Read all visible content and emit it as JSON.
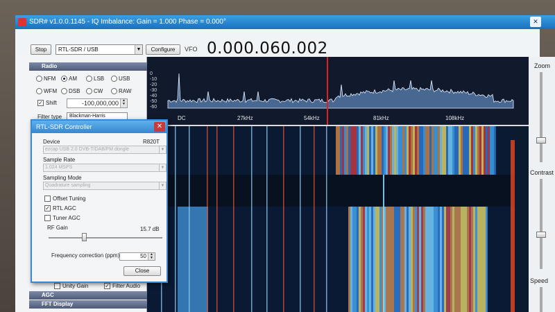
{
  "window": {
    "title": "SDR# v1.0.0.1145 - IQ Imbalance: Gain = 1.000 Phase = 0.000°",
    "close_glyph": "✕"
  },
  "toolbar": {
    "stop_label": "Stop",
    "source_value": "RTL-SDR / USB",
    "configure_label": "Configure",
    "vfo_label": "VFO",
    "vfo_value": "0.000.060.002"
  },
  "radio_panel": {
    "header": "Radio",
    "modes_row1": [
      "NFM",
      "AM",
      "LSB",
      "USB"
    ],
    "modes_row2": [
      "WFM",
      "DSB",
      "CW",
      "RAW"
    ],
    "selected_mode": "AM",
    "shift_label": "Shift",
    "shift_value": "-100,000,000",
    "filter_label": "Filter type",
    "filter_value": "Blackman-Harris"
  },
  "bottom_panel": {
    "unity_gain_label": "Unity Gain",
    "filter_audio_label": "Filter Audio",
    "agc_header": "AGC",
    "fft_header": "FFT Display"
  },
  "spectrum": {
    "db_ticks": [
      "0",
      "-10",
      "-20",
      "-30",
      "-40",
      "-50",
      "-60"
    ],
    "freq_labels": [
      "DC",
      "27kHz",
      "54kHz",
      "81kHz",
      "108kHz"
    ]
  },
  "right_panel": {
    "zoom_label": "Zoom",
    "contrast_label": "Contrast",
    "speed_label": "Speed"
  },
  "dialog": {
    "title": "RTL-SDR Controller",
    "close_glyph": "✕",
    "device_label": "Device",
    "device_tuner": "R820T",
    "device_value": "ezcap USB 2.0 DVB-T/DAB/FM dongle",
    "sample_rate_label": "Sample Rate",
    "sample_rate_value": "1.024 MSPS",
    "sampling_mode_label": "Sampling Mode",
    "sampling_mode_value": "Quadrature sampling",
    "offset_tuning_label": "Offset Tuning",
    "rtl_agc_label": "RTL AGC",
    "tuner_agc_label": "Tuner AGC",
    "rf_gain_label": "RF Gain",
    "rf_gain_value": "15.7 dB",
    "freq_corr_label": "Frequency correction (ppm)",
    "freq_corr_value": "50",
    "close_label": "Close",
    "check_glyph": "✓"
  }
}
